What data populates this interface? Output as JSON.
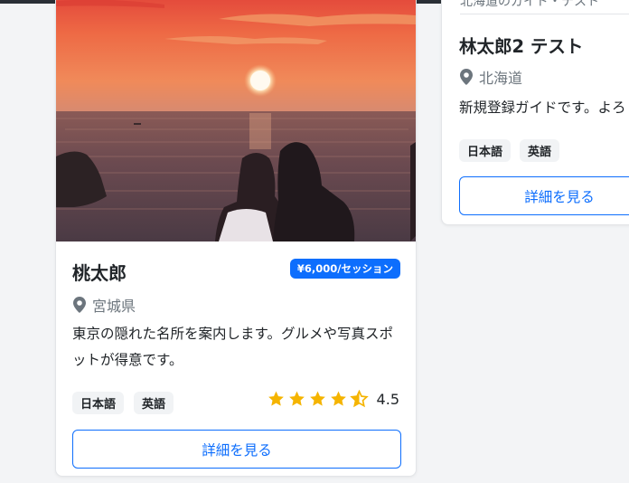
{
  "cards": [
    {
      "name": "桃太郎",
      "price": "¥6,000/セッション",
      "location": "宮城県",
      "description": "東京の隠れた名所を案内します。グルメや写真スポットが得意です。",
      "languages": [
        "日本語",
        "英語"
      ],
      "rating": 4.5,
      "rating_text": "4.5",
      "button_label": "詳細を見る"
    },
    {
      "header_cut": "北海道のガイド・テスト",
      "name": "林太郎2 テスト",
      "location": "北海道",
      "description": "新規登録ガイドです。よろしくお願いします。",
      "languages": [
        "日本語",
        "英語"
      ],
      "button_label": "詳細を見る"
    }
  ],
  "colors": {
    "accent": "#0d6efd",
    "star": "#f5b400",
    "muted": "#6c757d"
  }
}
